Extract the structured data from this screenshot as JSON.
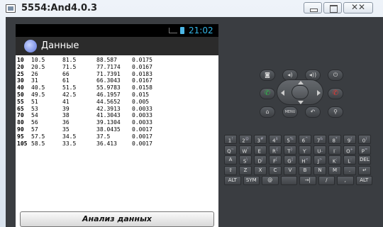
{
  "window": {
    "title": "5554:And4.0.3",
    "close_label": "ꟷꟷ"
  },
  "status_bar": {
    "signal": "3G",
    "time": "21:02"
  },
  "app": {
    "title": "Данные",
    "button_label": "Анализ данных"
  },
  "table": {
    "rows": [
      [
        "10",
        "10.5",
        "81.5",
        "88.587",
        "0.0175"
      ],
      [
        "20",
        "20.5",
        "71.5",
        "77.7174",
        "0.0167"
      ],
      [
        "25",
        "26",
        "66",
        "71.7391",
        "0.0183"
      ],
      [
        "30",
        "31",
        "61",
        "66.3043",
        "0.0167"
      ],
      [
        "40",
        "40.5",
        "51.5",
        "55.9783",
        "0.0158"
      ],
      [
        "50",
        "49.5",
        "42.5",
        "46.1957",
        "0.015"
      ],
      [
        "55",
        "51",
        "41",
        "44.5652",
        "0.005"
      ],
      [
        "65",
        "53",
        "39",
        "42.3913",
        "0.0033"
      ],
      [
        "70",
        "54",
        "38",
        "41.3043",
        "0.0033"
      ],
      [
        "80",
        "56",
        "36",
        "39.1304",
        "0.0033"
      ],
      [
        "90",
        "57",
        "35",
        "38.0435",
        "0.0017"
      ],
      [
        "95",
        "57.5",
        "34.5",
        "37.5",
        "0.0017"
      ],
      [
        "105",
        "58.5",
        "33.5",
        "36.413",
        "0.0017"
      ]
    ]
  },
  "controls": {
    "camera_icon": "camera-icon",
    "vol_down_icon": "volume-down-icon",
    "vol_up_icon": "volume-up-icon",
    "power_icon": "power-icon",
    "call_icon": "call-icon",
    "end_call_icon": "end-call-icon",
    "home_icon": "home-icon",
    "menu_label": "MENU",
    "back_icon": "back-icon",
    "search_icon": "search-icon"
  },
  "keyboard": {
    "row1": [
      [
        "1",
        "!"
      ],
      [
        "2",
        "@"
      ],
      [
        "3",
        "#"
      ],
      [
        "4",
        "$"
      ],
      [
        "5",
        "%"
      ],
      [
        "6",
        "^"
      ],
      [
        "7",
        "&"
      ],
      [
        "8",
        "*"
      ],
      [
        "9",
        "("
      ],
      [
        "0",
        ")"
      ]
    ],
    "row2": [
      [
        "Q",
        "~"
      ],
      [
        "W",
        "\""
      ],
      [
        "E",
        "`"
      ],
      [
        "R",
        "{"
      ],
      [
        "T",
        "}"
      ],
      [
        "Y",
        "-"
      ],
      [
        "U",
        "_"
      ],
      [
        "I",
        "-"
      ],
      [
        "O",
        "+"
      ],
      [
        "P",
        "="
      ]
    ],
    "row3": [
      [
        "A",
        ""
      ],
      [
        "S",
        "\\"
      ],
      [
        "D",
        "|"
      ],
      [
        "F",
        "["
      ],
      [
        "G",
        "]"
      ],
      [
        "H",
        "<"
      ],
      [
        "J",
        ">"
      ],
      [
        "K",
        ";"
      ],
      [
        "L",
        ":"
      ],
      [
        "DEL",
        ""
      ]
    ],
    "row4": [
      [
        "⇧",
        ""
      ],
      [
        "Z",
        ""
      ],
      [
        "X",
        ""
      ],
      [
        "C",
        ""
      ],
      [
        "V",
        ""
      ],
      [
        "B",
        ""
      ],
      [
        "N",
        ""
      ],
      [
        "M",
        ""
      ],
      [
        ".",
        ""
      ],
      [
        "↵",
        ""
      ]
    ],
    "row5": [
      [
        "ALT",
        ""
      ],
      [
        "SYM",
        ""
      ],
      [
        "@",
        ""
      ],
      [
        "",
        ""
      ],
      [
        "→|",
        ""
      ],
      [
        "/",
        ""
      ],
      [
        ",",
        ""
      ],
      [
        "ALT",
        ""
      ]
    ]
  },
  "colors": {
    "accent_time": "#33b5e5",
    "call_green": "#2fb84b",
    "end_red": "#e53935",
    "emulator_body": "#3a3d41"
  }
}
